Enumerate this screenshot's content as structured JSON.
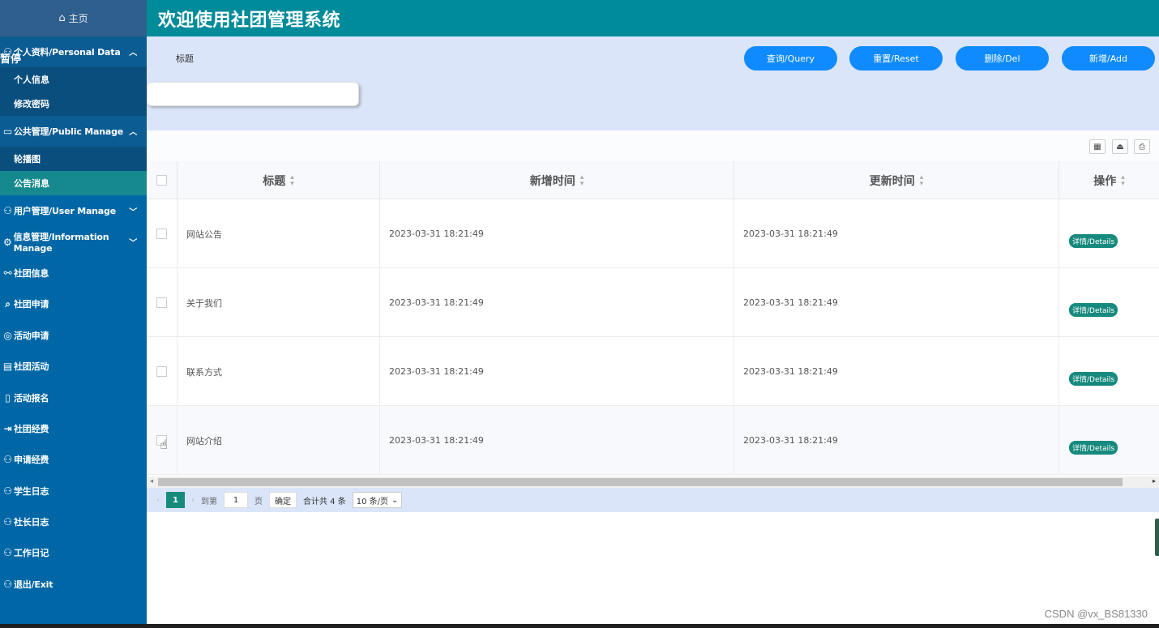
{
  "sidebar": {
    "home": "主页",
    "paused_text": "暂停",
    "groups": [
      {
        "label": "个人资料/Personal Data",
        "items": [
          "个人信息",
          "修改密码"
        ]
      },
      {
        "label": "公共管理/Public Manage",
        "items": [
          "轮播图",
          "公告消息"
        ]
      }
    ],
    "menu": [
      "用户管理/User Manage",
      "信息管理/Information Manage",
      "社团信息",
      "社团申请",
      "活动申请",
      "社团活动",
      "活动报名",
      "社团经费",
      "申请经费",
      "学生日志",
      "社长日志",
      "工作日记",
      "退出/Exit"
    ]
  },
  "header": {
    "title": "欢迎使用社团管理系统"
  },
  "search": {
    "label": "标题",
    "placeholder": "",
    "buttons": {
      "query": "查询/Query",
      "reset": "重置/Reset",
      "delete": "删除/Del",
      "add": "新增/Add"
    }
  },
  "table": {
    "columns": [
      "标题",
      "新增时间",
      "更新时间",
      "操作"
    ],
    "rows": [
      {
        "title": "网站公告",
        "created": "2023-03-31 18:21:49",
        "updated": "2023-03-31 18:21:49",
        "action": "详情/Details"
      },
      {
        "title": "关于我们",
        "created": "2023-03-31 18:21:49",
        "updated": "2023-03-31 18:21:49",
        "action": "详情/Details"
      },
      {
        "title": "联系方式",
        "created": "2023-03-31 18:21:49",
        "updated": "2023-03-31 18:21:49",
        "action": "详情/Details"
      },
      {
        "title": "网站介绍",
        "created": "2023-03-31 18:21:49",
        "updated": "2023-03-31 18:21:49",
        "action": "详情/Details"
      }
    ]
  },
  "pager": {
    "current": "1",
    "goto_label": "到第",
    "goto_value": "1",
    "page_unit": "页",
    "confirm": "确定",
    "total": "合计共 4 条",
    "page_size": "10 条/页"
  },
  "watermark": "CSDN @vx_BS81330",
  "colors": {
    "header": "#008b9a",
    "sidebar": "#0067a6",
    "button": "#0f8bff",
    "active": "#16898e",
    "panel": "#dae5f9"
  }
}
